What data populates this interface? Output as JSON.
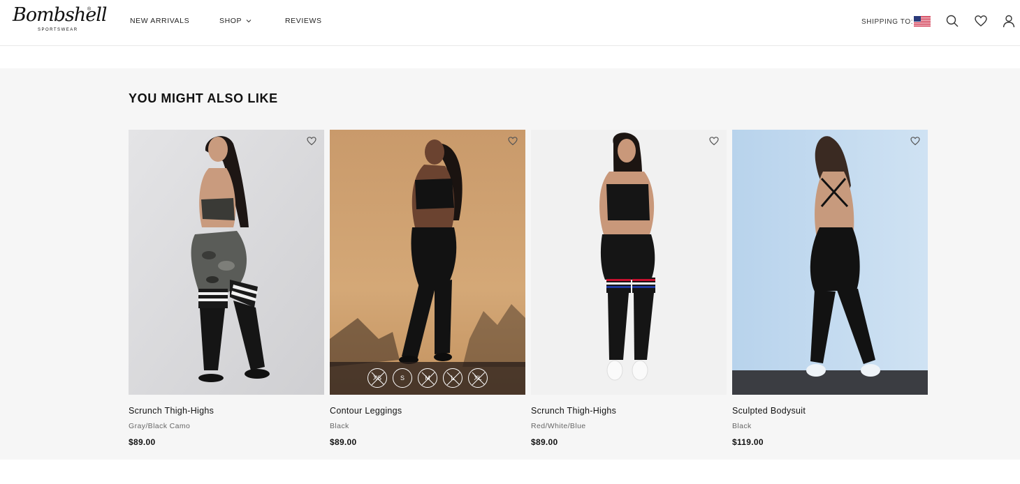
{
  "brand": {
    "logo_text": "Bombshell",
    "logo_subtext": "SPORTSWEAR",
    "logo_mark": "®"
  },
  "nav": {
    "items": [
      {
        "label": "NEW ARRIVALS"
      },
      {
        "label": "SHOP"
      },
      {
        "label": "REVIEWS"
      }
    ]
  },
  "header_tools": {
    "shipping_label": "SHIPPING TO:",
    "flag_icon": "us-flag-icon",
    "icons": [
      "search-icon",
      "heart-icon",
      "user-icon"
    ]
  },
  "section": {
    "title": "YOU MIGHT ALSO LIKE"
  },
  "products": [
    {
      "name": "Scrunch Thigh-Highs",
      "color": "Gray/Black Camo",
      "price": "$89.00"
    },
    {
      "name": "Contour Leggings",
      "color": "Black",
      "price": "$89.00",
      "sizes": [
        "XS",
        "S",
        "M",
        "L",
        "XL"
      ],
      "available_sizes": [
        "S"
      ]
    },
    {
      "name": "Scrunch Thigh-Highs",
      "color": "Red/White/Blue",
      "price": "$89.00"
    },
    {
      "name": "Sculpted Bodysuit",
      "color": "Black",
      "price": "$119.00"
    }
  ],
  "colors": {
    "section_bg": "#f6f6f6",
    "text": "#111111",
    "muted": "#666666"
  }
}
